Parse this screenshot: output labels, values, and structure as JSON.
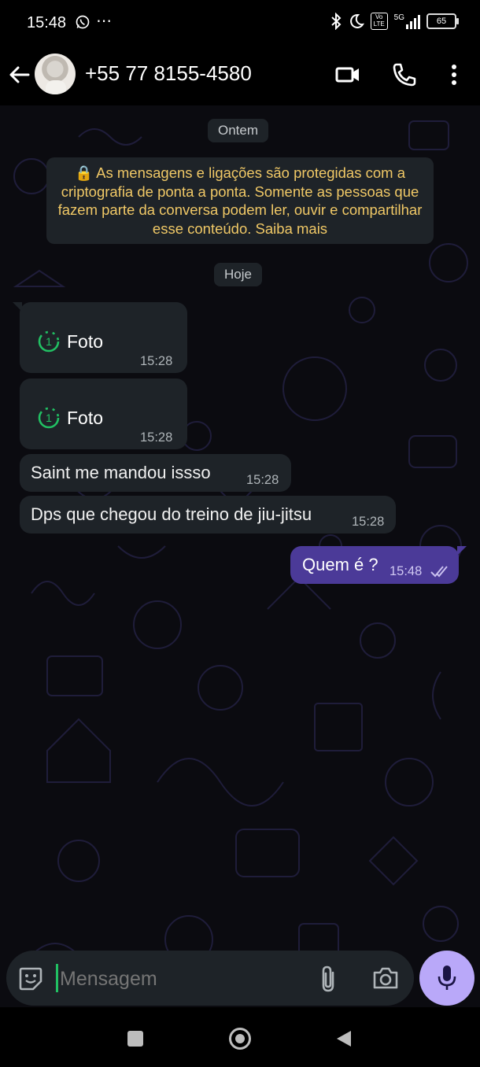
{
  "status_bar": {
    "time": "15:48",
    "whatsapp_icon": "whatsapp-icon",
    "more_dots": "⋯",
    "network_label_top": "Vo",
    "network_label_bottom": "LTE",
    "network_gen": "5G",
    "battery": "65"
  },
  "header": {
    "contact_name": "+55 77 8155-4580"
  },
  "chat": {
    "date_yesterday": "Ontem",
    "encryption_notice": "🔒 As mensagens e ligações são protegidas com a criptografia de ponta a ponta. Somente as pessoas que fazem parte da conversa podem ler, ouvir e compartilhar esse conteúdo. Saiba mais",
    "date_today": "Hoje",
    "messages": [
      {
        "direction": "in",
        "type": "view-once-photo",
        "view_once_icon": "1",
        "text": "Foto",
        "time": "15:28"
      },
      {
        "direction": "in",
        "type": "view-once-photo",
        "view_once_icon": "1",
        "text": "Foto",
        "time": "15:28"
      },
      {
        "direction": "in",
        "type": "text",
        "text": "Saint me mandou issso",
        "time": "15:28"
      },
      {
        "direction": "in",
        "type": "text",
        "text": "Dps que chegou do treino de jiu-jitsu",
        "time": "15:28"
      },
      {
        "direction": "out",
        "type": "text",
        "text": "Quem é ?",
        "time": "15:48",
        "status": "read"
      }
    ]
  },
  "composer": {
    "placeholder": "Mensagem"
  },
  "colors": {
    "background": "#000000",
    "incoming_bubble": "#1e2328",
    "outgoing_bubble": "#4b3a98",
    "mic_button": "#b9a8f9",
    "view_once_green": "#21c063",
    "notice_text": "#f0c866"
  }
}
